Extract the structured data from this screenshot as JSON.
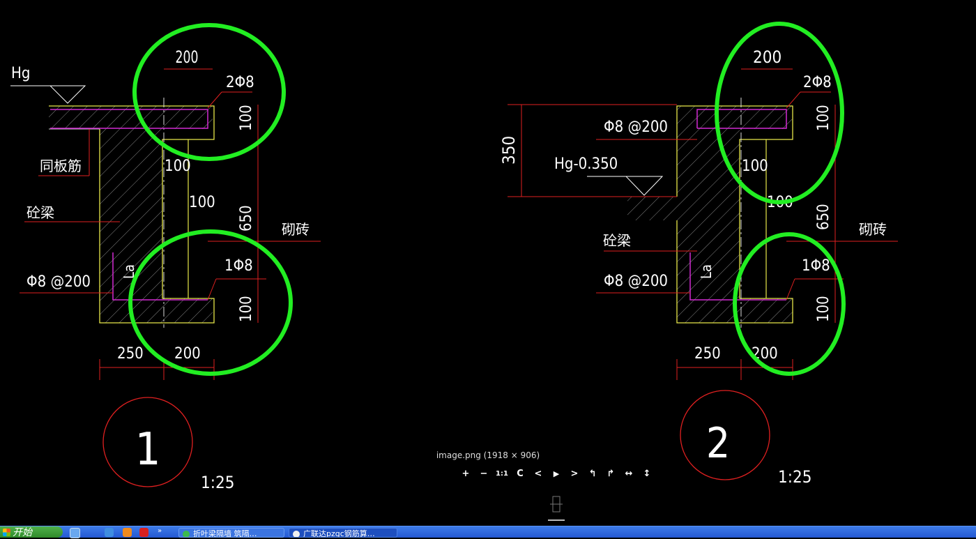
{
  "drawing": {
    "left_detail": {
      "top_width_dim": "200",
      "top_rebar": "2Φ8",
      "elevation_label": "Hg",
      "slab_rebar_label": "同板筋",
      "beam_label": "砼梁",
      "stirrup_label": "Φ8 @200",
      "lap_label": "La",
      "inner_dim_1": "100",
      "inner_dim_2": "100",
      "right_dim_top": "100",
      "right_dim_mid": "650",
      "right_dim_bottom": "100",
      "brick_label": "砌砖",
      "bottom_rebar": "1Φ8",
      "bottom_dim_1": "250",
      "bottom_dim_2": "200",
      "detail_number": "1",
      "scale": "1:25"
    },
    "right_detail": {
      "top_width_dim": "200",
      "top_rebar": "2Φ8",
      "height_dim": "350",
      "top_stirrup_label": "Φ8 @200",
      "elevation_label": "Hg-0.350",
      "beam_label": "砼梁",
      "stirrup_label": "Φ8 @200",
      "lap_label": "La",
      "inner_dim_1": "100",
      "inner_dim_2": "100",
      "right_dim_top": "100",
      "right_dim_mid": "650",
      "right_dim_bottom": "100",
      "brick_label": "砌砖",
      "bottom_rebar": "1Φ8",
      "bottom_dim_1": "250",
      "bottom_dim_2": "200",
      "detail_number": "2",
      "scale": "1:25"
    },
    "colors": {
      "background": "#000000",
      "highlight_circle": "#22ee22",
      "concrete_outline": "#e8e84a",
      "rebar": "#d22ad2",
      "leader": "#e02020",
      "text": "#ffffff"
    }
  },
  "viewer": {
    "caption": "image.png (1918 × 906)",
    "toolbar": [
      {
        "name": "zoom-in",
        "glyph": "+"
      },
      {
        "name": "zoom-out",
        "glyph": "−"
      },
      {
        "name": "actual-size",
        "glyph": "1:1"
      },
      {
        "name": "refresh",
        "glyph": "C"
      },
      {
        "name": "previous",
        "glyph": "<"
      },
      {
        "name": "play",
        "glyph": "▶"
      },
      {
        "name": "next",
        "glyph": ">"
      },
      {
        "name": "rotate-left",
        "glyph": "↰"
      },
      {
        "name": "rotate-right",
        "glyph": "↱"
      },
      {
        "name": "fit-width",
        "glyph": "↔"
      },
      {
        "name": "fit-height",
        "glyph": "↕"
      }
    ]
  },
  "taskbar": {
    "start_label": "开始",
    "items": [
      {
        "label": "折叶梁隔墙 筑隔…",
        "icon": "globe-icon"
      },
      {
        "label": "广联达pzgc钢筋算…",
        "icon": "app-icon"
      }
    ]
  }
}
